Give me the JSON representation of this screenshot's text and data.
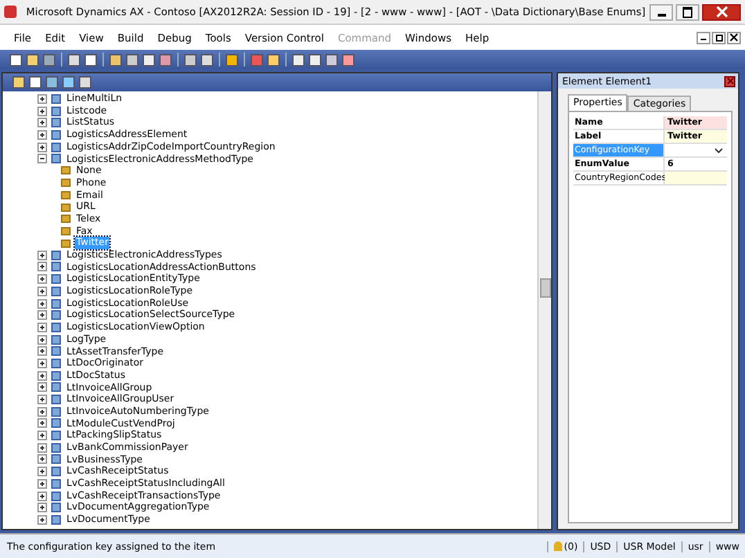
{
  "window": {
    "title": "Microsoft Dynamics AX - Contoso [AX2012R2A: Session ID - 19] -  [2 - www - www] - [AOT - \\Data Dictionary\\Base Enums]"
  },
  "menu": [
    {
      "label": "File",
      "disabled": false
    },
    {
      "label": "Edit",
      "disabled": false
    },
    {
      "label": "View",
      "disabled": false
    },
    {
      "label": "Build",
      "disabled": false
    },
    {
      "label": "Debug",
      "disabled": false
    },
    {
      "label": "Tools",
      "disabled": false
    },
    {
      "label": "Version Control",
      "disabled": false
    },
    {
      "label": "Command",
      "disabled": true
    },
    {
      "label": "Windows",
      "disabled": false
    },
    {
      "label": "Help",
      "disabled": false
    }
  ],
  "tree": {
    "items": [
      {
        "label": "LineMultiLn",
        "expanded": false,
        "selected": false
      },
      {
        "label": "Listcode",
        "expanded": false,
        "selected": false
      },
      {
        "label": "ListStatus",
        "expanded": false,
        "selected": false
      },
      {
        "label": "LogisticsAddressElement",
        "expanded": false,
        "selected": false
      },
      {
        "label": "LogisticsAddrZipCodeImportCountryRegion",
        "expanded": false,
        "selected": false
      },
      {
        "label": "LogisticsElectronicAddressMethodType",
        "expanded": true,
        "selected": false,
        "children": [
          {
            "label": "None",
            "selected": false
          },
          {
            "label": "Phone",
            "selected": false
          },
          {
            "label": "Email",
            "selected": false
          },
          {
            "label": "URL",
            "selected": false
          },
          {
            "label": "Telex",
            "selected": false
          },
          {
            "label": "Fax",
            "selected": false
          },
          {
            "label": "Twitter",
            "selected": true
          }
        ]
      },
      {
        "label": "LogisticsElectronicAddressTypes",
        "expanded": false,
        "selected": false
      },
      {
        "label": "LogisticsLocationAddressActionButtons",
        "expanded": false,
        "selected": false
      },
      {
        "label": "LogisticsLocationEntityType",
        "expanded": false,
        "selected": false
      },
      {
        "label": "LogisticsLocationRoleType",
        "expanded": false,
        "selected": false
      },
      {
        "label": "LogisticsLocationRoleUse",
        "expanded": false,
        "selected": false
      },
      {
        "label": "LogisticsLocationSelectSourceType",
        "expanded": false,
        "selected": false
      },
      {
        "label": "LogisticsLocationViewOption",
        "expanded": false,
        "selected": false
      },
      {
        "label": "LogType",
        "expanded": false,
        "selected": false
      },
      {
        "label": "LtAssetTransferType",
        "expanded": false,
        "selected": false
      },
      {
        "label": "LtDocOriginator",
        "expanded": false,
        "selected": false
      },
      {
        "label": "LtDocStatus",
        "expanded": false,
        "selected": false
      },
      {
        "label": "LtInvoiceAllGroup",
        "expanded": false,
        "selected": false
      },
      {
        "label": "LtInvoiceAllGroupUser",
        "expanded": false,
        "selected": false
      },
      {
        "label": "LtInvoiceAutoNumberingType",
        "expanded": false,
        "selected": false
      },
      {
        "label": "LtModuleCustVendProj",
        "expanded": false,
        "selected": false
      },
      {
        "label": "LtPackingSlipStatus",
        "expanded": false,
        "selected": false
      },
      {
        "label": "LvBankCommissionPayer",
        "expanded": false,
        "selected": false
      },
      {
        "label": "LvBusinessType",
        "expanded": false,
        "selected": false
      },
      {
        "label": "LvCashReceiptStatus",
        "expanded": false,
        "selected": false
      },
      {
        "label": "LvCashReceiptStatusIncludingAll",
        "expanded": false,
        "selected": false
      },
      {
        "label": "LvCashReceiptTransactionsType",
        "expanded": false,
        "selected": false
      },
      {
        "label": "LvDocumentAggregationType",
        "expanded": false,
        "selected": false
      },
      {
        "label": "LvDocumentType",
        "expanded": false,
        "selected": false
      }
    ]
  },
  "properties": {
    "title": "Element Element1",
    "tabs": [
      {
        "label": "Properties",
        "selected": true
      },
      {
        "label": "Categories",
        "selected": false
      }
    ],
    "rows": [
      {
        "name": "Name",
        "value": "Twitter",
        "bold": true,
        "selected": false,
        "kind": "text",
        "color": "#fde0e0"
      },
      {
        "name": "Label",
        "value": "Twitter",
        "bold": true,
        "selected": false,
        "kind": "text",
        "color": "#fffde0"
      },
      {
        "name": "ConfigurationKey",
        "bold": false,
        "selected": true,
        "kind": "dropdown",
        "color": "#ffffff"
      },
      {
        "name": "EnumValue",
        "value": "6",
        "bold": true,
        "selected": false,
        "kind": "text",
        "color": "#ffffff"
      },
      {
        "name": "CountryRegionCodes",
        "bold": false,
        "selected": false,
        "kind": "text",
        "color": "#fffde0"
      }
    ]
  },
  "status_bar": {
    "message": "The configuration key assigned to the item",
    "alerts": "(0)",
    "currency": "USD",
    "model": "USR Model",
    "user": "usr",
    "company": "www"
  }
}
